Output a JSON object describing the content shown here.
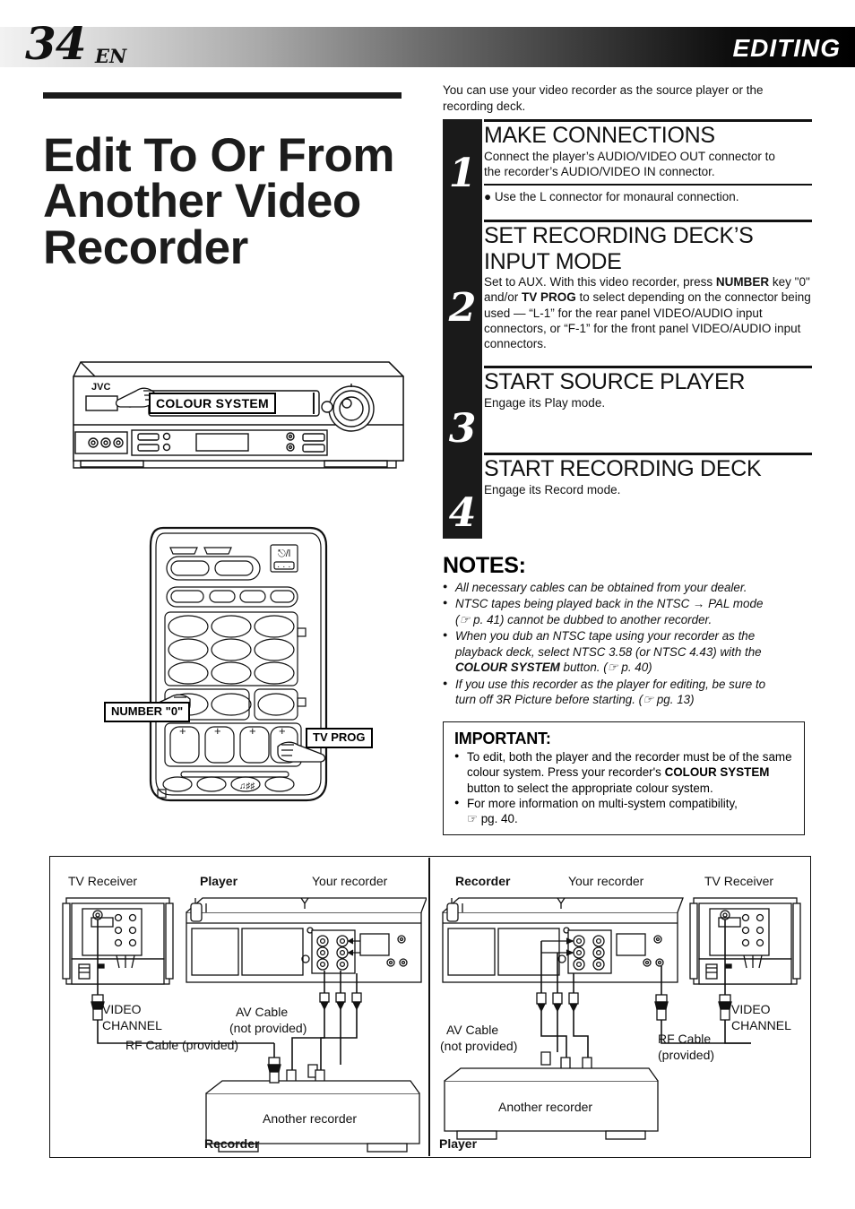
{
  "header": {
    "page_number": "34",
    "language_code": "EN",
    "section": "EDITING"
  },
  "left": {
    "title": "Edit To Or From Another Video Recorder",
    "vcr_callout": "COLOUR SYSTEM",
    "vcr_brand": "JVC",
    "remote_callouts": {
      "number_key": "NUMBER \"0\"",
      "tv_prog": "TV PROG"
    }
  },
  "right": {
    "intro": "You can use your video recorder as the source player or the recording deck.",
    "steps": [
      {
        "number": "1",
        "heading": "MAKE CONNECTIONS",
        "body_a": "Connect the player’s AUDIO/VIDEO OUT connector to",
        "body_b": "the recorder’s AUDIO/VIDEO IN connector.",
        "bullet": "● Use the L connector for monaural connection."
      },
      {
        "number": "2",
        "heading_line1": "SET RECORDING DECK’S",
        "heading_line2": "INPUT MODE",
        "body_1": "Set to AUX. With this video recorder, press ",
        "body_bold_1": "NUMBER",
        "body_2": "key \"0\" and/or ",
        "body_bold_2": "TV PROG",
        "body_3": " to select depending on the connector being used — “L-1” for the rear panel VIDEO/AUDIO input connectors, or “F-1” for the front panel VIDEO/AUDIO input connectors."
      },
      {
        "number": "3",
        "heading": "START SOURCE PLAYER",
        "body": "Engage its Play mode."
      },
      {
        "number": "4",
        "heading": "START RECORDING DECK",
        "body": "Engage its Record mode."
      }
    ],
    "notes": {
      "heading": "NOTES:",
      "items": [
        "All necessary cables can be obtained from your dealer.",
        "NTSC tapes being played back in the NTSC → PAL mode (☞ p. 41) cannot be dubbed to another recorder.",
        "When you dub an NTSC tape using your recorder as the playback deck, select NTSC 3.58 (or NTSC 4.43) with the COLOUR SYSTEM button. (☞ p. 40)",
        "If you use this recorder as the player for editing, be sure to turn off 3R Picture before starting. (☞ pg. 13)"
      ],
      "item2_pre": "NTSC tapes being played back in the NTSC",
      "item2_arrow": "→",
      "item2_post": "PAL mode",
      "item2_line2": "(☞ p. 41) cannot be dubbed to another recorder.",
      "item3_line1": "When you dub an NTSC tape using your recorder as the",
      "item3_line2": "playback deck, select NTSC 3.58 (or NTSC 4.43) with the",
      "item3_bold": "COLOUR SYSTEM",
      "item3_tail": " button. (☞ p. 40)",
      "item4_line1": "If you use this recorder as the player for editing, be sure to",
      "item4_line2": "turn off 3R Picture before starting. (☞ pg. 13)"
    },
    "important": {
      "heading": "IMPORTANT:",
      "item1_line1": "To edit, both the player and the recorder must be of the",
      "item1_line2": "same colour system. Press your recorder's ",
      "item1_bold1": "COLOUR",
      "item1_bold2": "SYSTEM",
      "item1_line3": " button to select the appropriate colour system.",
      "item2_line1": "For more information on multi-system compatibility,",
      "item2_line2": "☞ pg. 40."
    }
  },
  "diagram": {
    "left_panel": {
      "tv_receiver": "TV Receiver",
      "player": "Player",
      "your_recorder": "Your recorder",
      "video_channel_line1": "VIDEO",
      "video_channel_line2": "CHANNEL",
      "av_cable_line1": "AV Cable",
      "av_cable_line2": "(not provided)",
      "rf_cable": "RF Cable (provided)",
      "another_recorder": "Another recorder",
      "role_label": "Recorder"
    },
    "right_panel": {
      "recorder": "Recorder",
      "your_recorder": "Your recorder",
      "tv_receiver": "TV Receiver",
      "video_channel_line1": "VIDEO",
      "video_channel_line2": "CHANNEL",
      "av_cable_line1": "AV Cable",
      "av_cable_line2": "(not provided)",
      "rf_cable_line1": "RF Cable",
      "rf_cable_line2": "(provided)",
      "another_recorder": "Another recorder",
      "role_label": "Player"
    }
  }
}
